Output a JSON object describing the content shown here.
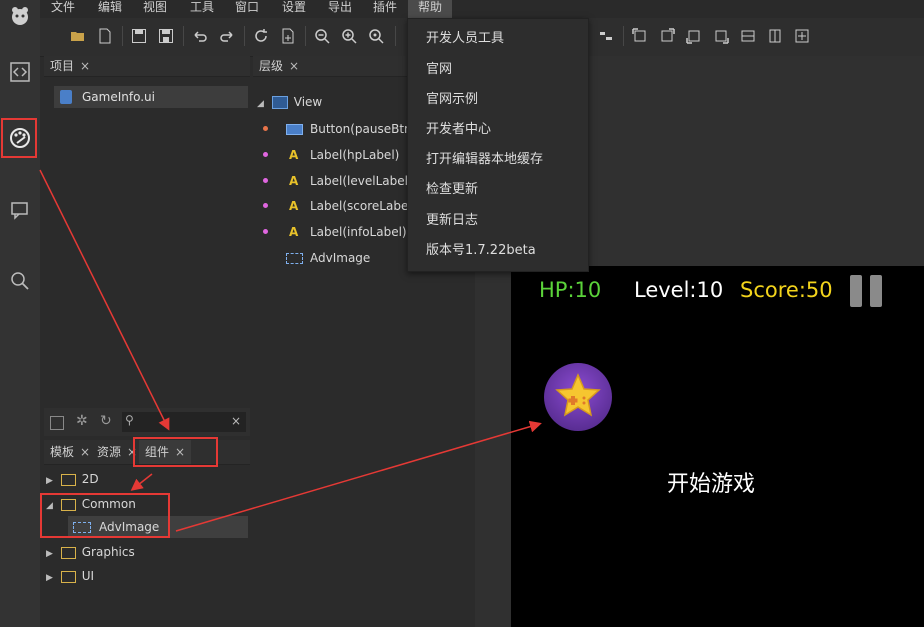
{
  "menubar": {
    "items": [
      "文件",
      "编辑",
      "视图",
      "工具",
      "窗口",
      "设置",
      "导出",
      "插件",
      "帮助"
    ]
  },
  "help_menu": {
    "items": [
      "开发人员工具",
      "官网",
      "官网示例",
      "开发者中心",
      "打开编辑器本地缓存",
      "检查更新",
      "更新日志",
      "版本号1.7.22beta"
    ]
  },
  "project_panel": {
    "tab": "项目",
    "file": "GameInfo.ui"
  },
  "hierarchy_panel": {
    "tab": "层级",
    "root": "View",
    "nodes": [
      {
        "label": "Button(pauseBtn)",
        "dot": "#e8744a",
        "icon": "button-icon"
      },
      {
        "label": "Label(hpLabel)",
        "dot": "#e066e0",
        "icon": "label-icon"
      },
      {
        "label": "Label(levelLabel)",
        "dot": "#e066e0",
        "icon": "label-icon"
      },
      {
        "label": "Label(scoreLabel)",
        "dot": "#e066e0",
        "icon": "label-icon"
      },
      {
        "label": "Label(infoLabel)",
        "dot": "#e066e0",
        "icon": "label-icon"
      },
      {
        "label": "AdvImage",
        "dot": "",
        "icon": "advimage-icon"
      }
    ]
  },
  "component_panel": {
    "tabs": [
      "模板",
      "资源",
      "组件"
    ],
    "tree": [
      {
        "label": "2D",
        "expanded": false
      },
      {
        "label": "Common",
        "expanded": true
      },
      {
        "label": "AdvImage",
        "child": true
      },
      {
        "label": "Graphics",
        "expanded": false
      },
      {
        "label": "UI",
        "expanded": false
      }
    ]
  },
  "game": {
    "hp": "HP:10",
    "level": "Level:10",
    "score": "Score:50",
    "info": "开始游戏",
    "hp_color": "#5bd33a",
    "level_color": "#ffffff",
    "score_color": "#f3d41c"
  },
  "colors": {
    "accent_red": "#e53935",
    "panel_bg": "#2b2b2b"
  }
}
